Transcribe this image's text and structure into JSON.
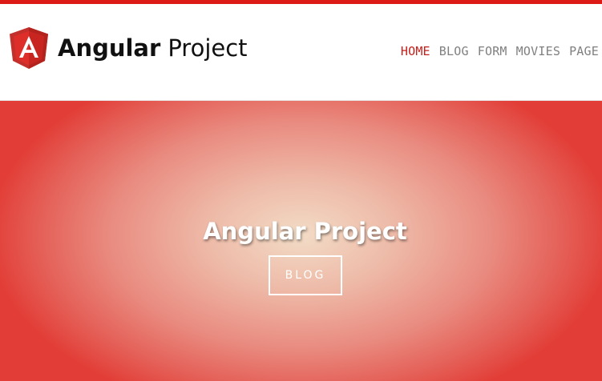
{
  "brand": {
    "logo_icon": "angular-shield-logo-icon",
    "title_strong": "Angular",
    "title_light": "Project"
  },
  "nav": {
    "items": [
      {
        "label": "HOME",
        "active": true
      },
      {
        "label": "BLOG",
        "active": false
      },
      {
        "label": "FORM",
        "active": false
      },
      {
        "label": "MOVIES",
        "active": false
      },
      {
        "label": "PAGE",
        "active": false
      }
    ]
  },
  "hero": {
    "title": "Angular Project",
    "button_label": "BLOG"
  },
  "colors": {
    "accent": "#dd1b16",
    "nav_active": "#c4201b",
    "nav_inactive": "#808080",
    "hero_center": "#f2dcc6",
    "hero_edge": "#e23d36"
  }
}
